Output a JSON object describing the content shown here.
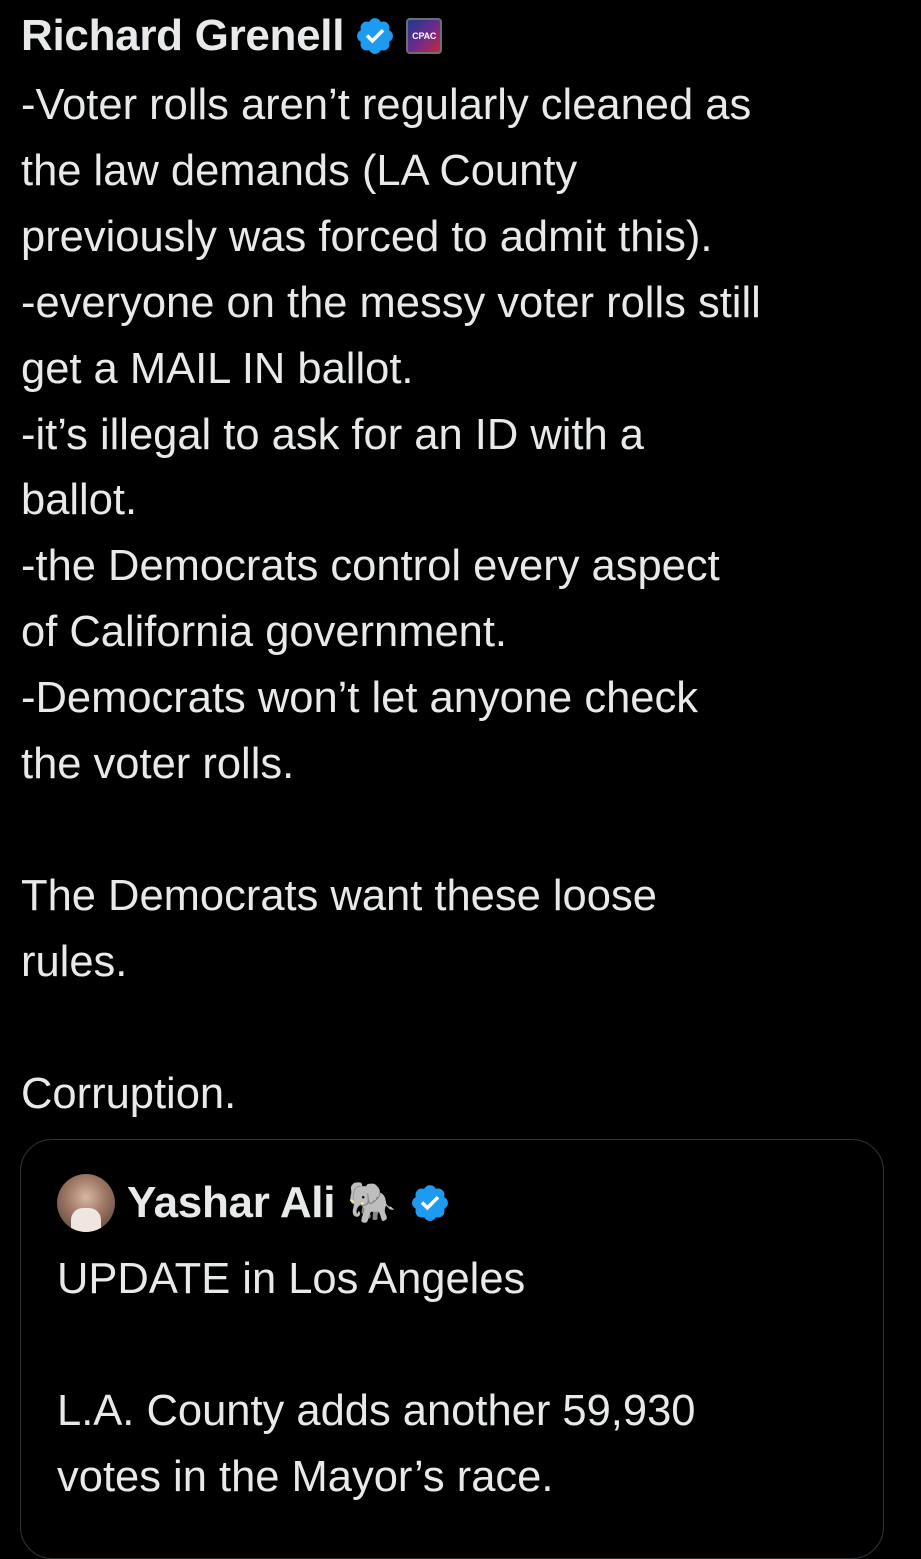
{
  "tweet": {
    "author_name": "Richard Grenell",
    "verified_icon": "verified-badge-icon",
    "affiliation_label": "CPAC",
    "lines": [
      "-Voter rolls aren’t regularly cleaned as",
      "the law demands (LA County",
      "previously was forced to admit this).",
      "-everyone on the messy voter rolls still",
      "get a MAIL IN ballot.",
      "-it’s illegal to ask for an ID with a",
      "ballot.",
      "-the Democrats control every aspect",
      "of California government.",
      "-Democrats won’t let anyone check",
      "the voter rolls.",
      "",
      "The Democrats want these loose",
      "rules.",
      "",
      "Corruption."
    ]
  },
  "quote": {
    "author_name": "Yashar Ali",
    "name_emoji": "🐘",
    "verified_icon": "verified-badge-icon",
    "lines": [
      "UPDATE in Los Angeles",
      "",
      "L.A. County adds another 59,930",
      "votes in the Mayor’s race."
    ]
  },
  "colors": {
    "background": "#000000",
    "text": "#e7e9ea",
    "verified_blue": "#1d9bf0",
    "card_border": "#2f3336"
  }
}
